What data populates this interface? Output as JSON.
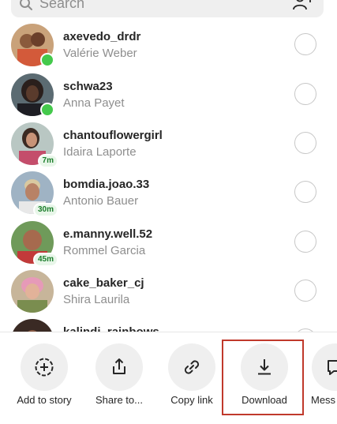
{
  "search": {
    "placeholder": "Search",
    "icon": "search-icon",
    "add_icon": "add-people-icon"
  },
  "contacts": [
    {
      "username": "axevedo_drdr",
      "full_name": "Valérie Weber",
      "status": "online"
    },
    {
      "username": "schwa23",
      "full_name": "Anna Payet",
      "status": "online"
    },
    {
      "username": "chantouflowergirl",
      "full_name": "Idaira Laporte",
      "active_ago": "7m"
    },
    {
      "username": "bomdia.joao.33",
      "full_name": "Antonio Bauer",
      "active_ago": "30m"
    },
    {
      "username": "e.manny.well.52",
      "full_name": "Rommel Garcia",
      "active_ago": "45m"
    },
    {
      "username": "cake_baker_cj",
      "full_name": "Shira Laurila"
    },
    {
      "username": "kalindi_rainbows",
      "full_name": ""
    }
  ],
  "actions": [
    {
      "label": "Add to story",
      "icon": "add-to-story-icon"
    },
    {
      "label": "Share to...",
      "icon": "share-icon"
    },
    {
      "label": "Copy link",
      "icon": "link-icon"
    },
    {
      "label": "Download",
      "icon": "download-icon"
    },
    {
      "label": "Mess",
      "icon": "message-icon"
    }
  ],
  "colors": {
    "online": "#44c94c",
    "highlight": "#c0392b",
    "secondary_text": "#8e8e8e"
  }
}
